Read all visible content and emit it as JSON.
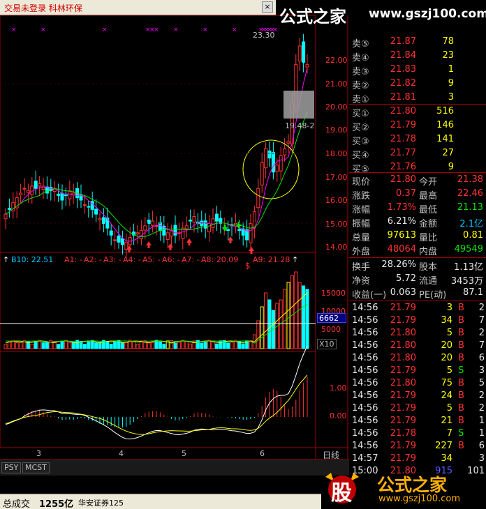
{
  "window": {
    "title": "交易未登录   科林环保",
    "close_glyph": "×"
  },
  "watermark": {
    "brand": "公式之家",
    "url": "www.gszj100.com",
    "logo_char": "股"
  },
  "chart": {
    "peak_label": "23.30",
    "low_label": "19.48-2",
    "dollar_mark": "$",
    "price_axis": [
      "22.00",
      "21.00",
      "20.00",
      "19.00",
      "18.00",
      "17.00",
      "16.00",
      "15.00",
      "14.00"
    ],
    "indicator_header": {
      "b10": "B10: 22.51",
      "a1": "A1: -",
      "a2": "A2: -",
      "a3": "A3: -",
      "a4": "A4: -",
      "a5": "A5: -",
      "a6": "A6: -",
      "a7": "A7: -",
      "a8": "A8: 20.09",
      "a9": "A9: 21.28"
    },
    "volume_axis": [
      "15000",
      "10000",
      "5000"
    ],
    "volume_badge": "6662",
    "volume_unit": "X10",
    "macd_axis": [
      "1.00",
      "0.00"
    ],
    "date_labels": [
      "3",
      "4",
      "5",
      "6"
    ],
    "period_label": "日线"
  },
  "order_book": {
    "asks": [
      {
        "label": "卖⑤",
        "price": "21.87",
        "vol": "78"
      },
      {
        "label": "卖④",
        "price": "21.84",
        "vol": "23"
      },
      {
        "label": "卖③",
        "price": "21.83",
        "vol": "1"
      },
      {
        "label": "卖②",
        "price": "21.82",
        "vol": "9"
      },
      {
        "label": "卖①",
        "price": "21.81",
        "vol": "3"
      }
    ],
    "bids": [
      {
        "label": "买①",
        "price": "21.80",
        "vol": "516"
      },
      {
        "label": "买②",
        "price": "21.79",
        "vol": "146"
      },
      {
        "label": "买③",
        "price": "21.78",
        "vol": "141"
      },
      {
        "label": "买④",
        "price": "21.77",
        "vol": "27"
      },
      {
        "label": "买⑤",
        "price": "21.76",
        "vol": "9"
      }
    ]
  },
  "stats": [
    {
      "l1": "现价",
      "v1": "21.80",
      "l2": "今开",
      "v2": "21.38",
      "c1": "red",
      "c2": "red"
    },
    {
      "l1": "涨跌",
      "v1": "0.37",
      "l2": "最高",
      "v2": "22.46",
      "c1": "red",
      "c2": "red"
    },
    {
      "l1": "涨幅",
      "v1": "1.73%",
      "l2": "最低",
      "v2": "21.13",
      "c1": "red",
      "c2": "grn"
    },
    {
      "l1": "振幅",
      "v1": "6.21%",
      "l2": "金额",
      "v2": "2.1亿",
      "c1": "wht",
      "c2": "cyan"
    },
    {
      "l1": "总量",
      "v1": "97613",
      "l2": "量比",
      "v2": "0.81",
      "c1": "yel",
      "c2": "yel"
    },
    {
      "l1": "外盘",
      "v1": "48064",
      "l2": "内盘",
      "v2": "49549",
      "c1": "red",
      "c2": "grn"
    }
  ],
  "fundamentals": [
    {
      "l1": "换手",
      "v1": "28.26%",
      "l2": "股本",
      "v2": "1.13亿"
    },
    {
      "l1": "净资",
      "v1": "5.72",
      "l2": "流通",
      "v2": "3453万"
    },
    {
      "l1": "收益(一)",
      "v1": "0.063",
      "l2": "PE(动)",
      "v2": "87.1"
    }
  ],
  "ticks": [
    {
      "time": "14:56",
      "price": "21.79",
      "vol": "3",
      "side": "B",
      "n": "2"
    },
    {
      "time": "14:56",
      "price": "21.79",
      "vol": "34",
      "side": "B",
      "n": "7"
    },
    {
      "time": "14:56",
      "price": "21.80",
      "vol": "5",
      "side": "B",
      "n": "2"
    },
    {
      "time": "14:56",
      "price": "21.80",
      "vol": "20",
      "side": "B",
      "n": "7"
    },
    {
      "time": "14:56",
      "price": "21.80",
      "vol": "20",
      "side": "B",
      "n": "6"
    },
    {
      "time": "14:56",
      "price": "21.79",
      "vol": "5",
      "side": "S",
      "n": "3"
    },
    {
      "time": "14:56",
      "price": "21.80",
      "vol": "75",
      "side": "B",
      "n": "5"
    },
    {
      "time": "14:56",
      "price": "21.79",
      "vol": "24",
      "side": "B",
      "n": "2"
    },
    {
      "time": "14:56",
      "price": "21.79",
      "vol": "5",
      "side": "B",
      "n": "2"
    },
    {
      "time": "14:56",
      "price": "21.79",
      "vol": "21",
      "side": "B",
      "n": "1"
    },
    {
      "time": "14:56",
      "price": "21.78",
      "vol": "7",
      "side": "S",
      "n": "1"
    },
    {
      "time": "14:56",
      "price": "21.79",
      "vol": "227",
      "side": "B",
      "n": "6"
    },
    {
      "time": "14:57",
      "price": "21.79",
      "vol": "34",
      "side": "",
      "n": "3"
    },
    {
      "time": "15:00",
      "price": "21.80",
      "vol": "915",
      "side": "",
      "n": "101"
    }
  ],
  "tabs": [
    "PSY",
    "MCST"
  ],
  "status_bar": {
    "volume_label": "总成交",
    "volume_value": "1255亿",
    "broker": "华安证券125"
  }
}
